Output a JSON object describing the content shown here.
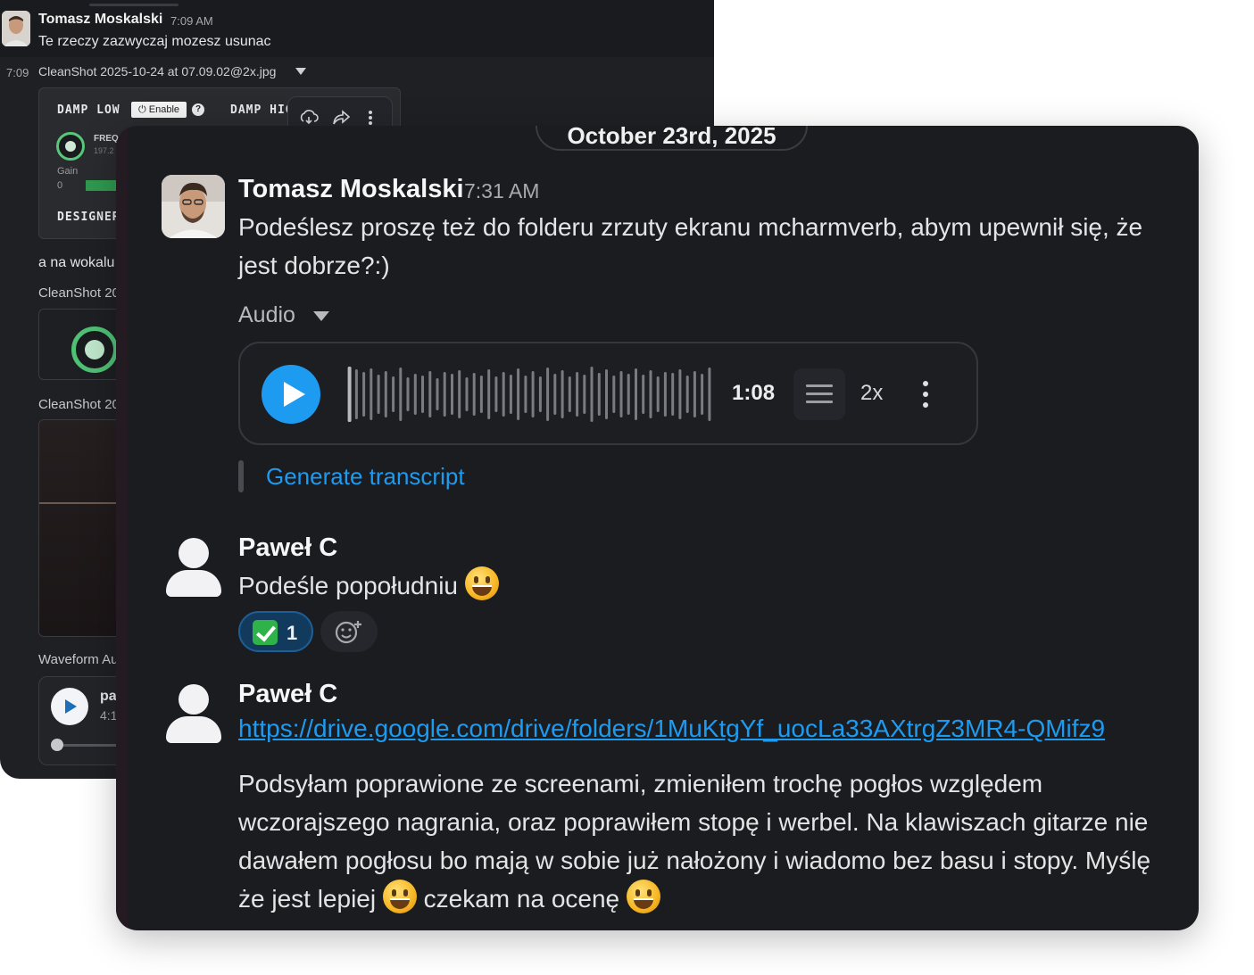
{
  "background_window": {
    "message": {
      "author": "Tomasz Moskalski",
      "time": "7:09 AM",
      "text": "Te rzeczy zazwyczaj mozesz usunac"
    },
    "attachment_time": "7:09",
    "attachment_name": "CleanShot 2025-10-24 at 07.09.02@2x.jpg",
    "plugin": {
      "damp_low": "DAMP LOW",
      "enable": "Enable",
      "help": "?",
      "damp_high": "DAMP HIG",
      "freq_label": "FREQ",
      "freq_value": "197.2",
      "gain_label": "Gain",
      "gain_value": "0",
      "designer": "DESIGNER"
    },
    "text_wokal": "a na wokalu",
    "cleanshot_1": "CleanShot 20",
    "cleanshot_2": "CleanShot 20",
    "waveform_label": "Waveform Au",
    "audio_title": "pa",
    "audio_sub": "4:1"
  },
  "date_divider": "October 23rd, 2025",
  "messages": [
    {
      "author": "Tomasz Moskalski",
      "time": "7:31 AM",
      "line1": "Podeślesz proszę też do folderu zrzuty ekranu mcharmverb, abym upewnił się, że",
      "line2": "jest dobrze?:)"
    },
    {
      "author": "Paweł C",
      "text": "Podeśle popołudniu"
    },
    {
      "author": "Paweł C",
      "link": "https://drive.google.com/drive/folders/1MuKtgYf_uocLa33AXtrgZ3MR4-QMifz9",
      "line1": "Podsyłam poprawione ze screenami, zmieniłem trochę pogłos względem",
      "line2": "wczorajszego nagrania, oraz poprawiłem stopę i werbel. Na klawiszach gitarze nie",
      "line3": "dawałem pogłosu bo mają w sobie już nałożony i wiadomo bez basu i stopy. Myślę",
      "line4a": "że jest lepiej",
      "line4b": "czekam na ocenę"
    }
  ],
  "audio": {
    "toggle_label": "Audio",
    "duration": "1:08",
    "speed": "2x",
    "generate_transcript": "Generate transcript"
  },
  "reaction": {
    "emoji": "white-check-mark-icon",
    "count": "1"
  },
  "colors": {
    "accent": "#1d9bf0",
    "panel_bg": "#1b1c1f",
    "reaction_bg": "#123a5c"
  }
}
